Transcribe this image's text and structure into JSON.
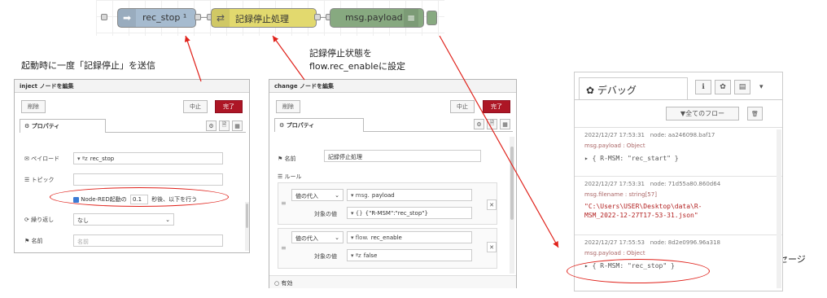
{
  "flow": {
    "inject_label": "rec_stop ¹",
    "change_label": "記録停止処理",
    "debug_label": "msg.payload"
  },
  "annotations": {
    "inject_note": "起動時に一度「記録停止」を送信",
    "change_note_line1": "記録停止状態を",
    "change_note_line2": "flow.rec_enableに設定",
    "debug_note": "記録停止のメッセージ"
  },
  "inject_dialog": {
    "title": "inject ノードを編集",
    "delete_btn": "削除",
    "cancel_btn": "中止",
    "done_btn": "完了",
    "tab_properties": "プロパティ",
    "payload_label": "ペイロード",
    "payload_type": "ªz",
    "payload_value": "rec_stop",
    "topic_label": "トピック",
    "topic_value": "",
    "once_prefix": "Node-RED起動の",
    "once_value": "0.1",
    "once_suffix": "秒後、以下を行う",
    "repeat_label": "繰り返し",
    "repeat_value": "なし",
    "name_label": "名前",
    "name_placeholder": "名前"
  },
  "change_dialog": {
    "title": "change ノードを編集",
    "delete_btn": "削除",
    "cancel_btn": "中止",
    "done_btn": "完了",
    "tab_properties": "プロパティ",
    "name_label": "名前",
    "name_value": "記録停止処理",
    "rules_label": "ルール",
    "rules": [
      {
        "action": "値の代入",
        "target_type": "msg.",
        "target": "payload",
        "value_label": "対象の値",
        "value_type": "{}",
        "value": "{\"R-MSM\":\"rec_stop\"}"
      },
      {
        "action": "値の代入",
        "target_type": "flow.",
        "target": "rec_enable",
        "value_label": "対象の値",
        "value_type": "ªz",
        "value": "false"
      }
    ],
    "enabled": "有効"
  },
  "debug_panel": {
    "title": "デバッグ",
    "filter_btn": "全てのフロー",
    "messages": [
      {
        "time": "2022/12/27 17:53:31",
        "node": "node: aa246098.baf17",
        "topic": "msg.payload : Object",
        "value": "{ R-MSM: \"rec_start\" }"
      },
      {
        "time": "2022/12/27 17:53:31",
        "node": "node: 71d55a80.860d64",
        "topic": "msg.filename : string[57]",
        "value1": "\"C:\\Users\\USER\\Desktop\\data\\R-",
        "value2": "MSM_2022-12-27T17-53-31.json\""
      },
      {
        "time": "2022/12/27 17:55:53",
        "node": "node: 8d2e0996.96a318",
        "topic": "msg.payload : Object",
        "value": "{ R-MSM: \"rec_stop\" }"
      }
    ]
  },
  "colors": {
    "inject": "#a6bbcf",
    "change": "#e2d96e",
    "debug": "#87a980",
    "done": "#ad1625",
    "annotation_red": "#e0221b"
  }
}
